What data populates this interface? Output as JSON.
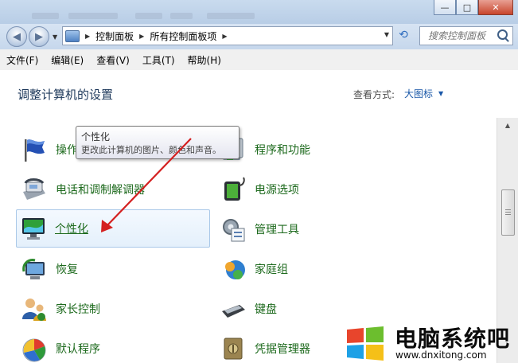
{
  "window": {
    "minimize_glyph": "—",
    "maximize_glyph": "□",
    "close_glyph": "✕"
  },
  "nav": {
    "back_glyph": "◀",
    "forward_glyph": "▶",
    "breadcrumbs": [
      "控制面板",
      "所有控制面板项"
    ],
    "search_placeholder": "搜索控制面板"
  },
  "menu": [
    "文件(F)",
    "编辑(E)",
    "查看(V)",
    "工具(T)",
    "帮助(H)"
  ],
  "header": {
    "title": "调整计算机的设置",
    "view_label": "查看方式:",
    "view_value": "大图标"
  },
  "items_left": [
    "操作中心",
    "电话和调制解调器",
    "个性化",
    "恢复",
    "家长控制",
    "默认程序"
  ],
  "items_right": [
    "程序和功能",
    "电源选项",
    "管理工具",
    "家庭组",
    "键盘",
    "凭据管理器"
  ],
  "tooltip": {
    "title": "个性化",
    "description": "更改此计算机的图片、颜色和声音。"
  },
  "watermark": {
    "text": "电脑系统吧",
    "url": "www.dnxitong.com"
  },
  "colors": {
    "link_green": "#1d6a1d",
    "annotation_arrow": "#d42020",
    "accent_blue": "#1a58a8"
  }
}
